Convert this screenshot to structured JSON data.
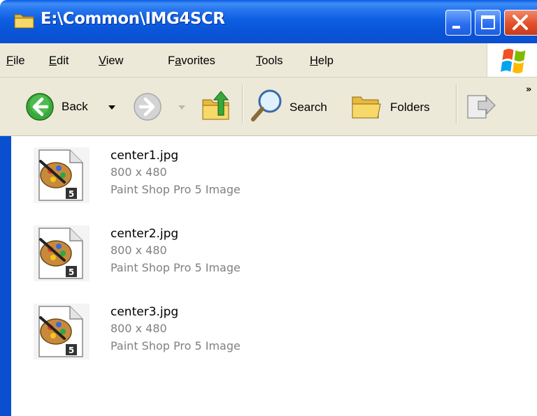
{
  "window": {
    "title": "E:\\Common\\IMG4SCR",
    "buttons": [
      "minimize",
      "maximize",
      "close"
    ]
  },
  "menu": {
    "items": [
      {
        "label": "File",
        "accel": "F",
        "rest": "ile"
      },
      {
        "label": "Edit",
        "accel": "E",
        "rest": "dit"
      },
      {
        "label": "View",
        "accel": "V",
        "rest": "iew"
      },
      {
        "label": "Favorites",
        "pre": "F",
        "accel": "a",
        "rest": "vorites"
      },
      {
        "label": "Tools",
        "accel": "T",
        "rest": "ools"
      },
      {
        "label": "Help",
        "accel": "H",
        "rest": "elp"
      }
    ]
  },
  "toolbar": {
    "back_label": "Back",
    "search_label": "Search",
    "folders_label": "Folders",
    "more_glyph": "»"
  },
  "files": [
    {
      "name": "center1.jpg",
      "dimensions": "800 x 480",
      "type": "Paint Shop Pro 5 Image",
      "icon_badge": "5"
    },
    {
      "name": "center2.jpg",
      "dimensions": "800 x 480",
      "type": "Paint Shop Pro 5 Image",
      "icon_badge": "5"
    },
    {
      "name": "center3.jpg",
      "dimensions": "800 x 480",
      "type": "Paint Shop Pro 5 Image",
      "icon_badge": "5"
    }
  ],
  "colors": {
    "titlebar": "#0a55d8",
    "chrome": "#ece9d8",
    "secondary_text": "#808080"
  }
}
